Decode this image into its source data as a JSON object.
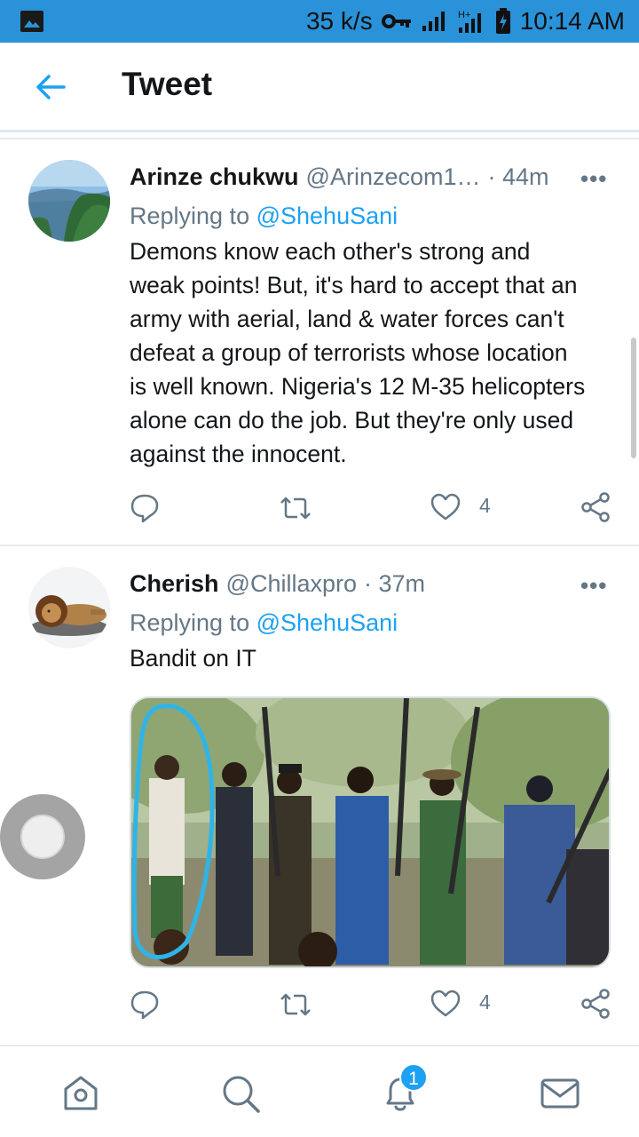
{
  "status_bar": {
    "speed": "35 k/s",
    "time": "10:14 AM",
    "icons": [
      "image-icon",
      "vpn-key-icon",
      "signal-icon",
      "h-plus-signal-icon",
      "battery-icon"
    ]
  },
  "header": {
    "title": "Tweet",
    "back_icon": "arrow-left-icon"
  },
  "tweets": [
    {
      "name": "Arinze chukwu",
      "handle": "@Arinzecom1…",
      "time": "· 44m",
      "replying_prefix": "Replying to",
      "replying_to": "@ShehuSani",
      "text_lines": [
        "Demons know each other's strong and",
        "weak points! But, it's hard to accept that an",
        "army with aerial, land & water forces can't",
        "defeat a group of terrorists whose location",
        "is well known. Nigeria's 12 M-35 helicopters",
        "alone can do the job. But they're only used",
        "against the innocent."
      ],
      "like_count": "4",
      "more": "•••"
    },
    {
      "name": "Cherish",
      "handle": "@Chillaxpro",
      "time": "· 37m",
      "replying_prefix": "Replying to",
      "replying_to": "@ShehuSani",
      "text_lines": [
        "Bandit on IT"
      ],
      "like_count": "4",
      "more": "•••"
    }
  ],
  "bottom_nav": {
    "items": [
      "home-icon",
      "search-icon",
      "notifications-icon",
      "messages-icon"
    ],
    "notification_badge": "1"
  },
  "colors": {
    "accent": "#1da1f2",
    "status_bar": "#2a92d9",
    "secondary_text": "#657786"
  }
}
